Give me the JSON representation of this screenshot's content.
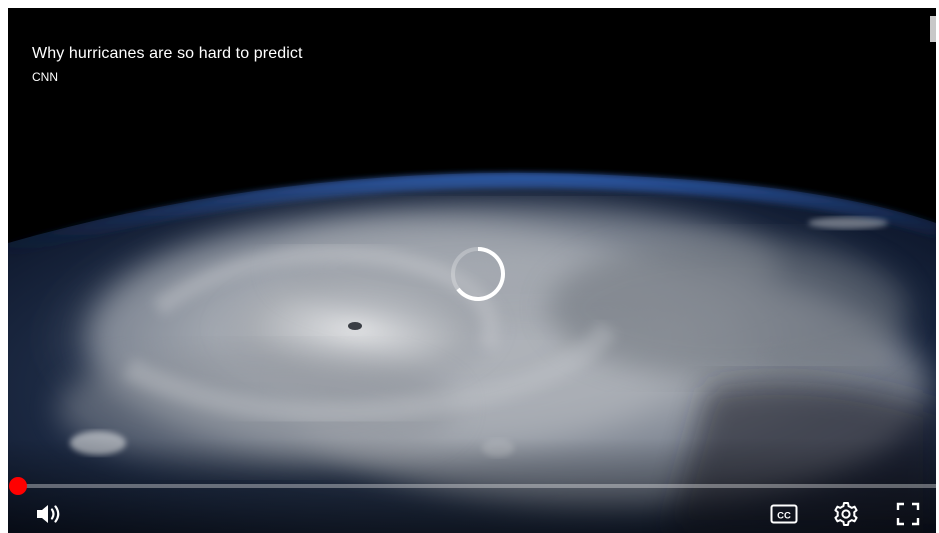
{
  "video": {
    "title": "Why hurricanes are so hard to predict",
    "channel": "CNN",
    "loading": true
  },
  "progress": {
    "played_fraction": 0.0
  },
  "controls": {
    "volume_icon": "volume-icon",
    "cc_icon": "closed-captions-icon",
    "cc_label": "CC",
    "settings_icon": "gear-icon",
    "fullscreen_icon": "fullscreen-icon"
  },
  "colors": {
    "accent": "#ff0000",
    "text": "#ffffff",
    "background": "#000000"
  }
}
